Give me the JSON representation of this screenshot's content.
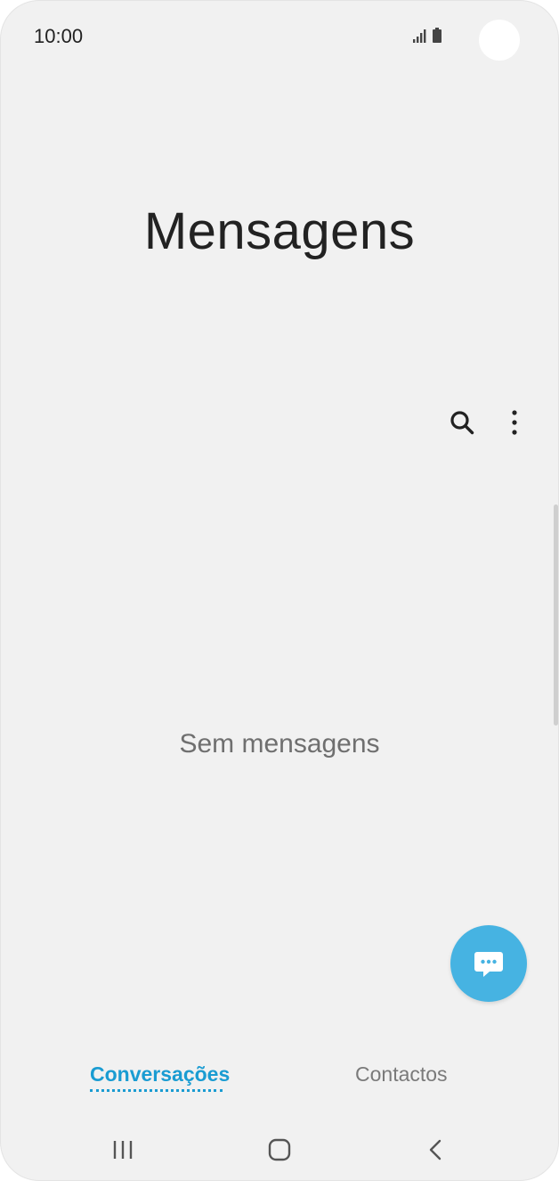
{
  "status_bar": {
    "time": "10:00",
    "icons": [
      "signal-icon",
      "battery-icon"
    ]
  },
  "header": {
    "title": "Mensagens"
  },
  "toolbar": {
    "actions": [
      "search-icon",
      "more-options-icon"
    ]
  },
  "main": {
    "empty_state": "Sem mensagens"
  },
  "fab": {
    "icon": "new-message-icon",
    "color": "#46b3e2"
  },
  "tabs": [
    {
      "label": "Conversações",
      "active": true
    },
    {
      "label": "Contactos",
      "active": false
    }
  ],
  "colors": {
    "accent": "#1a9cd2",
    "background": "#f1f1f1"
  },
  "navigation_bar": {
    "buttons": [
      "recents-icon",
      "home-icon",
      "back-icon"
    ]
  }
}
